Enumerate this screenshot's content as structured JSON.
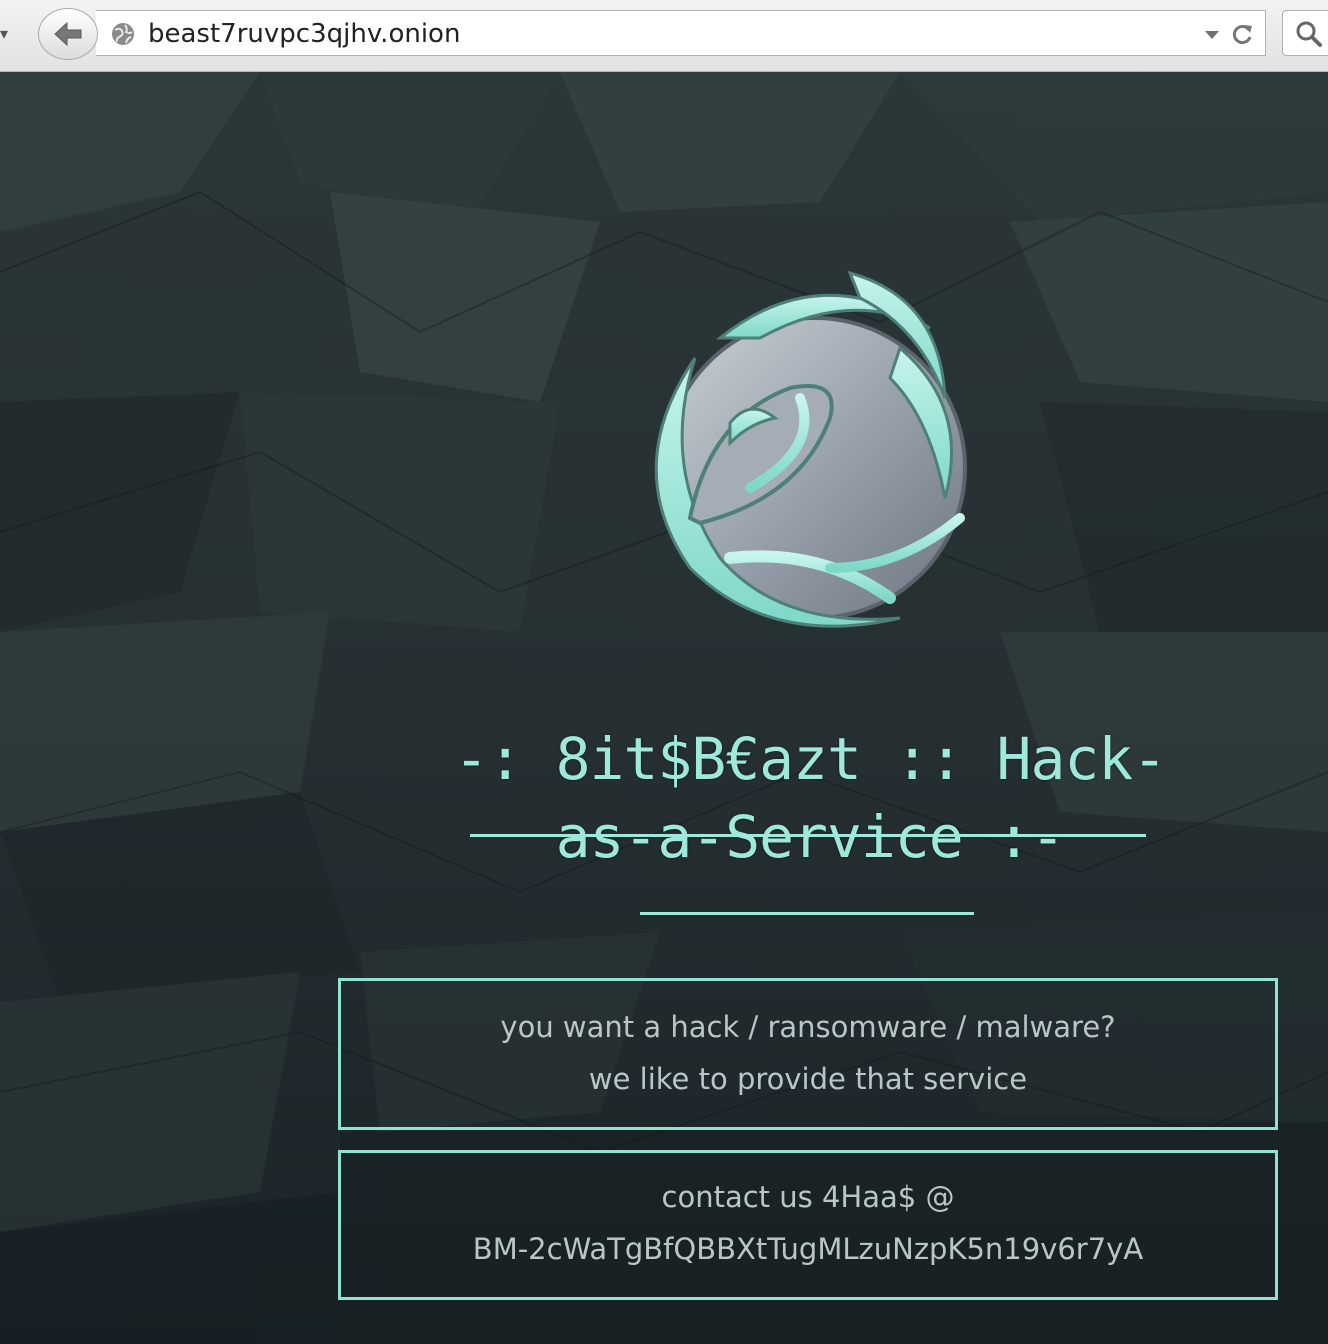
{
  "browser": {
    "url": "beast7ruvpc3qjhv.onion"
  },
  "page": {
    "title": "-: 8it$B€azt :: Hack-as-a-Service :-",
    "pitch_lines": [
      "you want a hack / ransomware / malware?",
      "we like to provide that service"
    ],
    "contact_lines": [
      "contact us 4Haa$ @",
      "BM-2cWaTgBfQBBXtTugMLzuNzpK5n19v6r7yA"
    ]
  },
  "colors": {
    "accent": "#8fe3d2",
    "text_muted": "#b8c6c8",
    "background": "#1f2a2e"
  },
  "icons": {
    "back": "back-arrow-icon",
    "site": "globe-icon",
    "dropdown": "dropdown-arrow-icon",
    "reload": "reload-icon",
    "search": "search-icon",
    "logo": "phoenix-logo-icon"
  }
}
